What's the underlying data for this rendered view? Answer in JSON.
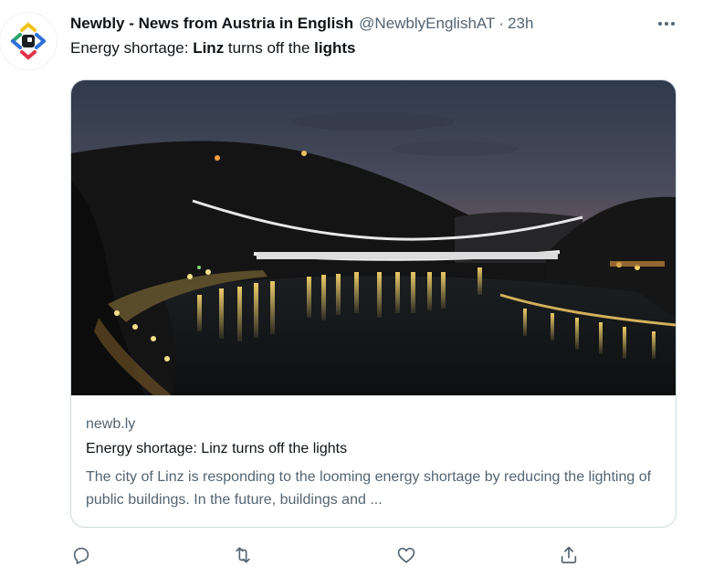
{
  "tweet": {
    "display_name": "Newbly - News from Austria in English",
    "handle": "@NewblyEnglishAT",
    "separator": "·",
    "time": "23h",
    "text_parts": [
      {
        "text": "Energy shortage: ",
        "bold": false
      },
      {
        "text": "Linz",
        "bold": true
      },
      {
        "text": " turns off the ",
        "bold": false
      },
      {
        "text": "lights",
        "bold": true
      }
    ]
  },
  "card": {
    "domain": "newb.ly",
    "title": "Energy shortage: Linz turns off the lights",
    "description": "The city of Linz is responding to the looming energy shortage by reducing the lighting of public buildings. In the future, buildings and ..."
  },
  "icons": {
    "more": "more-horizontal-icon",
    "reply": "reply-icon",
    "retweet": "retweet-icon",
    "like": "heart-icon",
    "share": "share-icon",
    "avatar": "newbly-logo-icon"
  },
  "colors": {
    "text_primary": "#0f1419",
    "text_secondary": "#536471",
    "border": "#cfd9de",
    "logo_blue": "#2f6fd8",
    "logo_yellow": "#f2c21b",
    "logo_red": "#e0344b",
    "logo_green": "#29a36a"
  }
}
